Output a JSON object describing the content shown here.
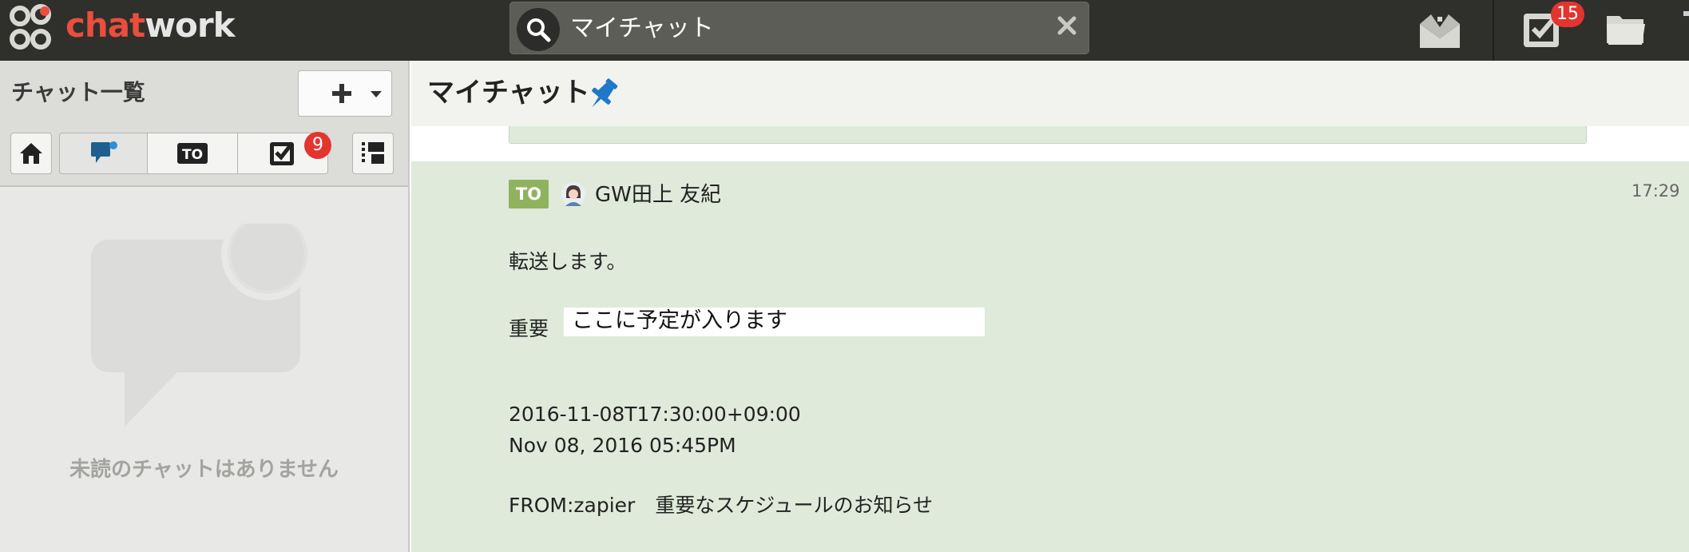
{
  "app": {
    "logo_part1": "chat",
    "logo_part2": "work"
  },
  "topbar": {
    "search_value": "マイチャット",
    "task_badge": "15"
  },
  "sidebar": {
    "title": "チャット一覧",
    "task_badge": "9",
    "empty_text": "未読のチャットはありません"
  },
  "room": {
    "title": "マイチャット"
  },
  "message": {
    "to_label": "TO",
    "sender": "GW田上 友紀",
    "time": "17:29",
    "intro": "転送します。",
    "label": "重要",
    "schedule": "ここに予定が入ります",
    "datetime_iso": "2016-11-08T17:30:00+09:00",
    "datetime_text": "Nov 08, 2016 05:45PM",
    "from_line": "FROM:zapier　重要なスケジュールのお知らせ"
  },
  "colors": {
    "topbar_bg": "#2f2f2b",
    "brand_red": "#ea4e3d",
    "badge_red": "#e3342f",
    "message_bg": "#dfeadb",
    "to_tag": "#8fb35d",
    "pin_blue": "#1f78c8"
  },
  "icons": [
    "chatwork-logo-icon",
    "search-icon",
    "close-icon",
    "contact-mail-icon",
    "task-icon",
    "folder-icon",
    "plus-icon",
    "caret-down-icon",
    "home-icon",
    "mention-icon",
    "to-icon",
    "task-filter-icon",
    "tree-view-icon",
    "pin-icon"
  ]
}
